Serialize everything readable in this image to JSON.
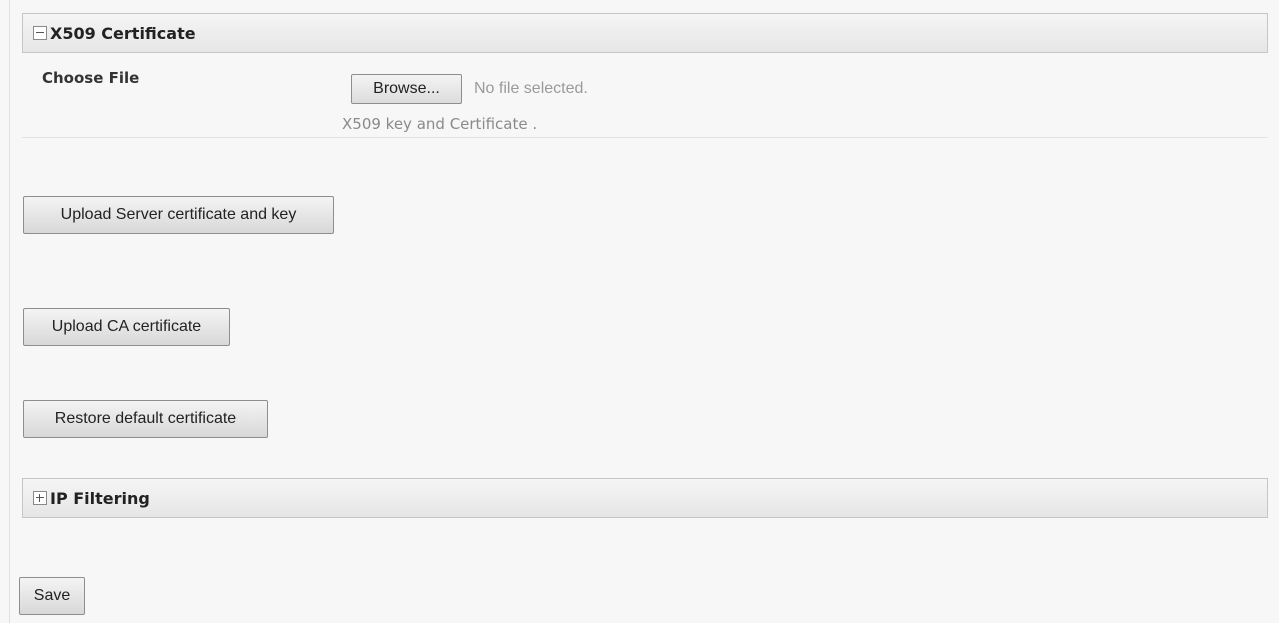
{
  "x509_section": {
    "title": "X509 Certificate",
    "expanded": true,
    "toggle_icon": "minus-box-icon"
  },
  "choose_file": {
    "label": "Choose File",
    "browse_label": "Browse...",
    "status": "No file selected.",
    "hint": "X509 key and Certificate ."
  },
  "actions": {
    "upload_server": "Upload Server certificate and key",
    "upload_ca": "Upload CA certificate",
    "restore_default": "Restore default certificate"
  },
  "ip_filtering_section": {
    "title": "IP Filtering",
    "expanded": false,
    "toggle_icon": "plus-box-icon"
  },
  "footer": {
    "save_label": "Save"
  }
}
